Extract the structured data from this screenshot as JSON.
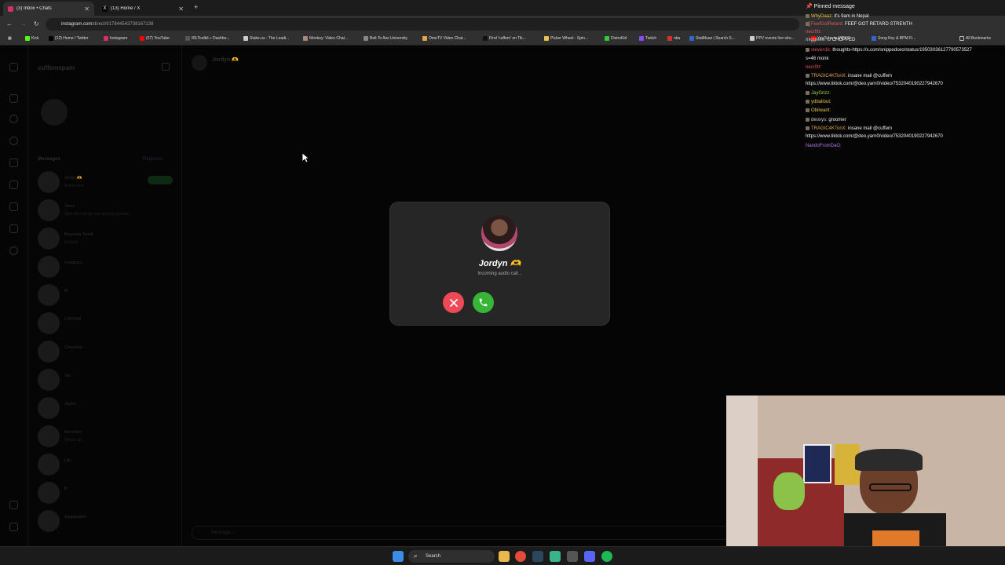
{
  "browser": {
    "tabs": [
      {
        "title": "(3) Inbox • Chats",
        "active": true
      },
      {
        "title": "(13) Home / X",
        "active": false
      }
    ],
    "new_tab": "+",
    "url_host": "instagram.com",
    "url_path": "/direct/t/17844543738167138",
    "bookmarks": [
      "Kick",
      "(12) Home / Twitter",
      "Instagram",
      "(57) YouTube",
      "IRLToolkit » Dashbo...",
      "Stake.us - The Leadi...",
      "Monkey: Video Chat...",
      "Belt To Ass University",
      "OmeTV Video Chat...",
      "Find 'cuffem' on Tik...",
      "Picker Wheel - Spin...",
      "DistroKid",
      "Twitch",
      "nba",
      "StatMuse | Search S...",
      "PPV events live stre...",
      "YouTube to MP3 D...",
      "Song Key & BPM Fi...",
      "All Bookmarks"
    ]
  },
  "instagram": {
    "username": "cuffemspam",
    "messages_heading": "Messages",
    "requests_label": "Requests",
    "header_name": "Jordyn 🫶",
    "conversations": [
      {
        "name": "Jordyn 🫶",
        "snippet": "Active now"
      },
      {
        "name": "Jason",
        "snippet": "Who the hell are you anyway jackass"
      },
      {
        "name": "Breyanna Terrell",
        "snippet": "lol hehe"
      },
      {
        "name": "Instagram",
        "snippet": ""
      },
      {
        "name": "Bi",
        "snippet": ""
      },
      {
        "name": "CUFFEM",
        "snippet": ""
      },
      {
        "name": "Cheyenne",
        "snippet": ""
      },
      {
        "name": "Jas",
        "snippet": ""
      },
      {
        "name": "Jaylen",
        "snippet": ""
      },
      {
        "name": "Mercedes",
        "snippet": "What's up"
      },
      {
        "name": "Lilly",
        "snippet": ""
      },
      {
        "name": "B",
        "snippet": ""
      },
      {
        "name": "Sagebrushin",
        "snippet": ""
      }
    ],
    "message_placeholder": "Message..."
  },
  "call_modal": {
    "caller_name": "Jordyn 🫶",
    "status": "Incoming audio call...",
    "decline_icon": "close-icon",
    "accept_icon": "phone-icon"
  },
  "stream_chat": {
    "pinned_label": "Pinned message",
    "messages": [
      {
        "user": "WhyDaaz:",
        "text": "it's 9am in Nepal",
        "color": "#e8c34a"
      },
      {
        "user": "FeefGotRetard:",
        "text": "FEEF GOT RETARD STRENTH",
        "color": "#e05a5a"
      },
      {
        "user": "necr0tt:",
        "text": "",
        "color": "#e05a5a"
      },
      {
        "user": "miggleee:",
        "text": "U CHOPPED",
        "color": "#cfcfcf"
      },
      {
        "user": "steven1k:",
        "text": "thoughts-https://x.com/snippedceo/status/19503036127790573527",
        "color": "#e05a5a"
      },
      {
        "user": "",
        "text": "s=46 monk",
        "color": "#ffffff"
      },
      {
        "user": "necr0tt:",
        "text": "",
        "color": "#e05a5a"
      },
      {
        "user": "TRAGIC4KTonX:",
        "text": "insane mail @cuffem",
        "color": "#e8a44a"
      },
      {
        "user": "",
        "text": "https://www.tiktok.com/@deo.yarn0/video/7532040190227942670",
        "color": "#ffffff"
      },
      {
        "user": "JayGrizz:",
        "text": "",
        "color": "#9ad84a"
      },
      {
        "user": "ydballout:",
        "text": "",
        "color": "#e8c34a"
      },
      {
        "user": "Obiiwant:",
        "text": "",
        "color": "#e8c34a"
      },
      {
        "user": "deoxys:",
        "text": "groomer",
        "color": "#cfcfcf"
      },
      {
        "user": "TRAGIC4KTonX:",
        "text": "insane mail @cuffem",
        "color": "#e8a44a"
      },
      {
        "user": "",
        "text": "https://www.tiktok.com/@deo.yarn0/video/7532040190227942670",
        "color": "#ffffff"
      },
      {
        "user": "NandoFromDaO:",
        "text": "",
        "color": "#b07ae8"
      }
    ]
  },
  "taskbar": {
    "search_label": "Search"
  }
}
